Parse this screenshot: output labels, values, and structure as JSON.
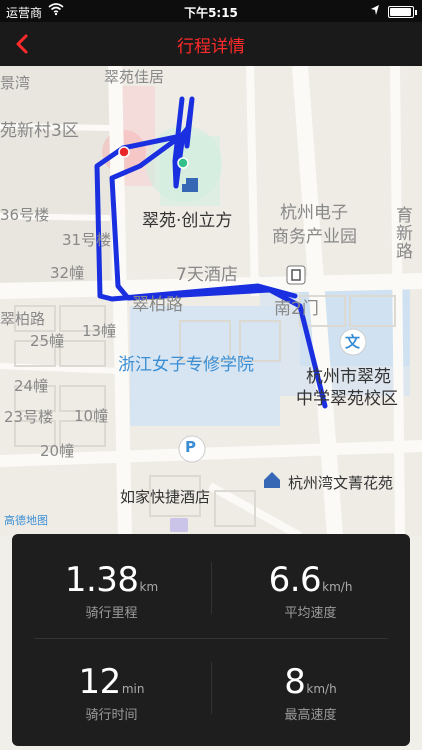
{
  "status_bar": {
    "carrier": "运营商",
    "time": "下午5:15",
    "battery_level": 0.95
  },
  "nav": {
    "title": "行程详情"
  },
  "map": {
    "labels": {
      "jingwan": "景湾",
      "cuiyuan_jiayuan": "翠苑佳居",
      "yuan_xincun3": "苑新村3区",
      "b36": "36号楼",
      "b31": "31号楼",
      "b32": "32幢",
      "cuibai_road_w": "翠柏路",
      "b13": "13幢",
      "b25": "25幢",
      "b24": "24幢",
      "b23": "23号楼",
      "b10": "10幢",
      "b20": "20幢",
      "cuiyuan_chuanglifang": "翠苑·创立方",
      "hangzhou_dianzi_1": "杭州电子",
      "hangzhou_dianzi_2": "商务产业园",
      "yuxin_road": "育新路",
      "hotel_7days": "7天酒店",
      "cuibai_road": "翠柏路",
      "south_gate": "南2门",
      "zhejiang_women": "浙江女子专修学院",
      "hz_cuiyuan_school_1": "杭州市翠苑",
      "hz_cuiyuan_school_2": "中学翠苑校区",
      "hz_wanwen": "杭州湾文菁花苑",
      "rujia_hotel": "如家快捷酒店",
      "gaode_logo": "高德地图",
      "parking": "P",
      "school_icon": "文"
    }
  },
  "stats": {
    "distance": {
      "value": "1.38",
      "unit": "km",
      "label": "骑行里程"
    },
    "avg_speed": {
      "value": "6.6",
      "unit": "km/h",
      "label": "平均速度"
    },
    "duration": {
      "value": "12",
      "unit": "min",
      "label": "骑行时间"
    },
    "max_speed": {
      "value": "8",
      "unit": "km/h",
      "label": "最高速度"
    }
  },
  "colors": {
    "nav_title": "#ff2a2a",
    "route": "#1a2fe0",
    "start_marker": "#e8252a",
    "end_marker": "#33c08a"
  }
}
